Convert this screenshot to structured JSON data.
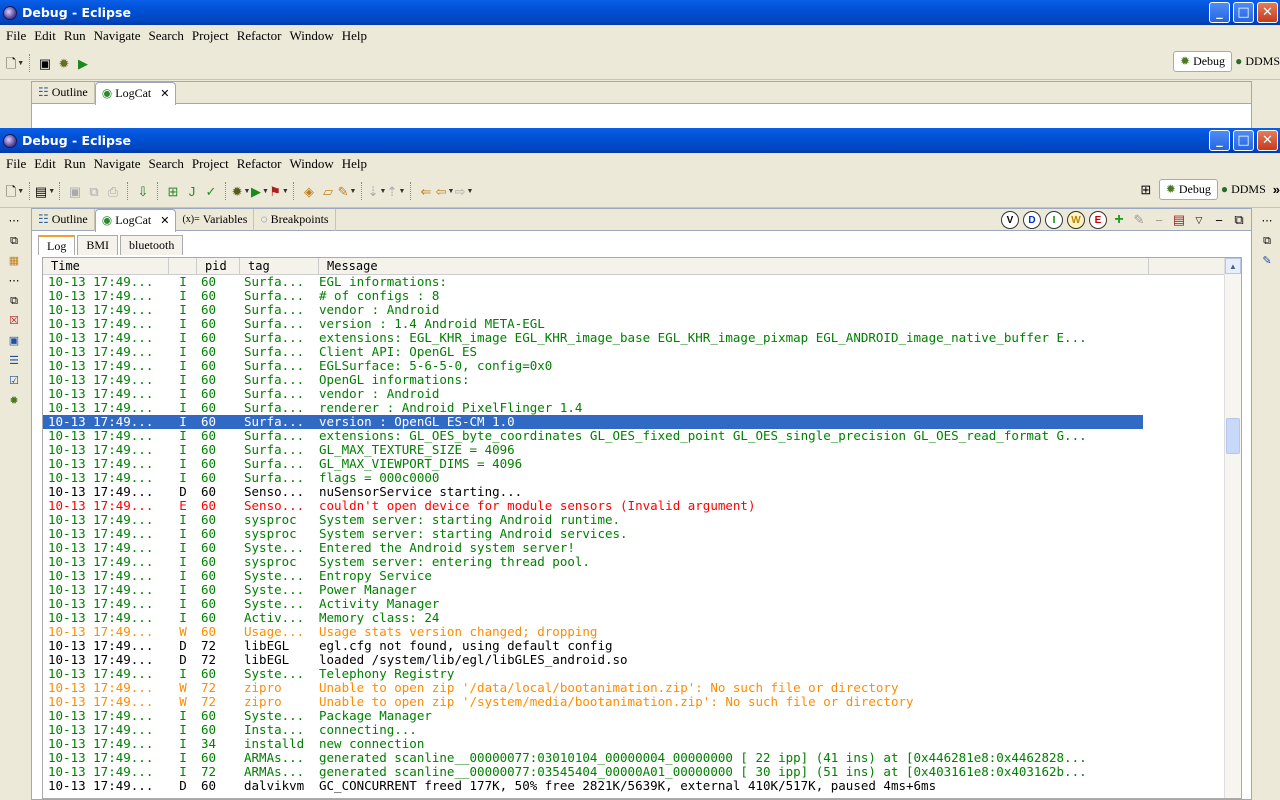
{
  "window": {
    "title": "Debug - Eclipse",
    "buttons": {
      "minimize": "_",
      "maximize": "□",
      "close": "✕"
    }
  },
  "menu": [
    "File",
    "Edit",
    "Run",
    "Navigate",
    "Search",
    "Project",
    "Refactor",
    "Window",
    "Help"
  ],
  "perspectives": {
    "debug": "Debug",
    "ddms": "DDMS",
    "more": "»"
  },
  "view_tabs": [
    {
      "label": "Outline"
    },
    {
      "label": "LogCat",
      "close": "✕"
    },
    {
      "label": "Variables",
      "prefix": "(x)="
    },
    {
      "label": "Breakpoints"
    }
  ],
  "log_levels": [
    "V",
    "D",
    "I",
    "W",
    "E"
  ],
  "sub_tabs": [
    "Log",
    "BMI",
    "bluetooth"
  ],
  "columns": {
    "time": "Time",
    "pid": "pid",
    "tag": "tag",
    "message": "Message"
  },
  "log_rows": [
    {
      "time": "10-13 17:49...",
      "level": "I",
      "pid": "60",
      "tag": "Surfa...",
      "message": "EGL informations:"
    },
    {
      "time": "10-13 17:49...",
      "level": "I",
      "pid": "60",
      "tag": "Surfa...",
      "message": "# of configs : 8"
    },
    {
      "time": "10-13 17:49...",
      "level": "I",
      "pid": "60",
      "tag": "Surfa...",
      "message": "vendor    : Android"
    },
    {
      "time": "10-13 17:49...",
      "level": "I",
      "pid": "60",
      "tag": "Surfa...",
      "message": "version   : 1.4 Android META-EGL"
    },
    {
      "time": "10-13 17:49...",
      "level": "I",
      "pid": "60",
      "tag": "Surfa...",
      "message": "extensions: EGL_KHR_image EGL_KHR_image_base EGL_KHR_image_pixmap EGL_ANDROID_image_native_buffer E..."
    },
    {
      "time": "10-13 17:49...",
      "level": "I",
      "pid": "60",
      "tag": "Surfa...",
      "message": "Client API: OpenGL ES"
    },
    {
      "time": "10-13 17:49...",
      "level": "I",
      "pid": "60",
      "tag": "Surfa...",
      "message": "EGLSurface: 5-6-5-0, config=0x0"
    },
    {
      "time": "10-13 17:49...",
      "level": "I",
      "pid": "60",
      "tag": "Surfa...",
      "message": "OpenGL informations:"
    },
    {
      "time": "10-13 17:49...",
      "level": "I",
      "pid": "60",
      "tag": "Surfa...",
      "message": "vendor    : Android"
    },
    {
      "time": "10-13 17:49...",
      "level": "I",
      "pid": "60",
      "tag": "Surfa...",
      "message": "renderer  : Android PixelFlinger 1.4"
    },
    {
      "time": "10-13 17:49...",
      "level": "I",
      "pid": "60",
      "tag": "Surfa...",
      "message": "version   : OpenGL ES-CM 1.0",
      "selected": true
    },
    {
      "time": "10-13 17:49...",
      "level": "I",
      "pid": "60",
      "tag": "Surfa...",
      "message": "extensions: GL_OES_byte_coordinates GL_OES_fixed_point GL_OES_single_precision GL_OES_read_format G..."
    },
    {
      "time": "10-13 17:49...",
      "level": "I",
      "pid": "60",
      "tag": "Surfa...",
      "message": "GL_MAX_TEXTURE_SIZE = 4096"
    },
    {
      "time": "10-13 17:49...",
      "level": "I",
      "pid": "60",
      "tag": "Surfa...",
      "message": "GL_MAX_VIEWPORT_DIMS = 4096"
    },
    {
      "time": "10-13 17:49...",
      "level": "I",
      "pid": "60",
      "tag": "Surfa...",
      "message": "flags = 000c0000"
    },
    {
      "time": "10-13 17:49...",
      "level": "D",
      "pid": "60",
      "tag": "Senso...",
      "message": "nuSensorService starting..."
    },
    {
      "time": "10-13 17:49...",
      "level": "E",
      "pid": "60",
      "tag": "Senso...",
      "message": "couldn't open device for module sensors (Invalid argument)"
    },
    {
      "time": "10-13 17:49...",
      "level": "I",
      "pid": "60",
      "tag": "sysproc",
      "message": "System server: starting Android runtime."
    },
    {
      "time": "10-13 17:49...",
      "level": "I",
      "pid": "60",
      "tag": "sysproc",
      "message": "System server: starting Android services."
    },
    {
      "time": "10-13 17:49...",
      "level": "I",
      "pid": "60",
      "tag": "Syste...",
      "message": "Entered the Android system server!"
    },
    {
      "time": "10-13 17:49...",
      "level": "I",
      "pid": "60",
      "tag": "sysproc",
      "message": "System server: entering thread pool."
    },
    {
      "time": "10-13 17:49...",
      "level": "I",
      "pid": "60",
      "tag": "Syste...",
      "message": "Entropy Service"
    },
    {
      "time": "10-13 17:49...",
      "level": "I",
      "pid": "60",
      "tag": "Syste...",
      "message": "Power Manager"
    },
    {
      "time": "10-13 17:49...",
      "level": "I",
      "pid": "60",
      "tag": "Syste...",
      "message": "Activity Manager"
    },
    {
      "time": "10-13 17:49...",
      "level": "I",
      "pid": "60",
      "tag": "Activ...",
      "message": "Memory class: 24"
    },
    {
      "time": "10-13 17:49...",
      "level": "W",
      "pid": "60",
      "tag": "Usage...",
      "message": "Usage stats version changed; dropping"
    },
    {
      "time": "10-13 17:49...",
      "level": "D",
      "pid": "72",
      "tag": "libEGL",
      "message": "egl.cfg not found, using default config"
    },
    {
      "time": "10-13 17:49...",
      "level": "D",
      "pid": "72",
      "tag": "libEGL",
      "message": "loaded /system/lib/egl/libGLES_android.so"
    },
    {
      "time": "10-13 17:49...",
      "level": "I",
      "pid": "60",
      "tag": "Syste...",
      "message": "Telephony Registry"
    },
    {
      "time": "10-13 17:49...",
      "level": "W",
      "pid": "72",
      "tag": "zipro",
      "message": "Unable to open zip '/data/local/bootanimation.zip': No such file or directory"
    },
    {
      "time": "10-13 17:49...",
      "level": "W",
      "pid": "72",
      "tag": "zipro",
      "message": "Unable to open zip '/system/media/bootanimation.zip': No such file or directory"
    },
    {
      "time": "10-13 17:49...",
      "level": "I",
      "pid": "60",
      "tag": "Syste...",
      "message": "Package Manager"
    },
    {
      "time": "10-13 17:49...",
      "level": "I",
      "pid": "60",
      "tag": "Insta...",
      "message": "connecting..."
    },
    {
      "time": "10-13 17:49...",
      "level": "I",
      "pid": "34",
      "tag": "installd",
      "message": "new connection"
    },
    {
      "time": "10-13 17:49...",
      "level": "I",
      "pid": "60",
      "tag": "ARMAs...",
      "message": "generated scanline__00000077:03010104_00000004_00000000 [ 22 ipp] (41 ins) at [0x446281e8:0x4462828..."
    },
    {
      "time": "10-13 17:49...",
      "level": "I",
      "pid": "72",
      "tag": "ARMAs...",
      "message": "generated scanline__00000077:03545404_00000A01_00000000 [ 30 ipp] (51 ins) at [0x403161e8:0x403162b..."
    },
    {
      "time": "10-13 17:49...",
      "level": "D",
      "pid": "60",
      "tag": "dalvikvm",
      "message": "GC_CONCURRENT freed 177K, 50% free 2821K/5639K, external 410K/517K, paused 4ms+6ms"
    }
  ],
  "colors": {
    "info": "#008000",
    "debug": "#000000",
    "error": "#ff0000",
    "warn": "#ff8c00",
    "selection": "#316ac5"
  }
}
